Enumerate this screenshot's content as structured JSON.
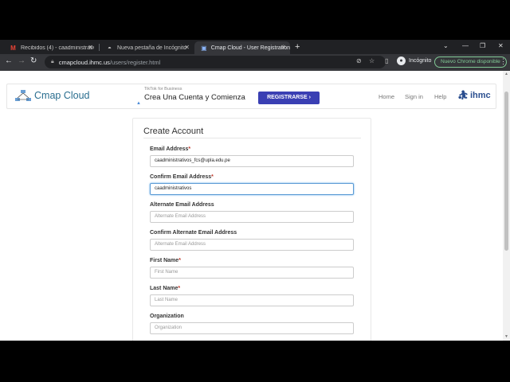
{
  "browser": {
    "tabs": [
      {
        "label": "Recibidos (4) - caadministrativos",
        "icon": "gmail-icon"
      },
      {
        "label": "Nueva pestaña de Incógnito",
        "icon": "incognito-icon"
      },
      {
        "label": "Cmap Cloud - User Registration",
        "icon": "cmap-icon"
      }
    ],
    "url_host": "cmapcloud.ihmc.us",
    "url_path": "/users/register.html",
    "profile_label": "Incógnito",
    "update_label": "Nuevo Chrome disponible"
  },
  "header": {
    "logo_text": "Cmap Cloud",
    "ad": {
      "sponsor": "TikTok for Business",
      "title": "Crea Una Cuenta y Comienza",
      "button": "REGISTRARSE ›"
    },
    "nav": [
      "Home",
      "Sign in",
      "Help"
    ],
    "org_logo": "ihmc"
  },
  "form": {
    "title": "Create Account",
    "fields": [
      {
        "label": "Email Address",
        "required": true,
        "value": "caadministrativos_fcs@upla.edu.pe",
        "placeholder": ""
      },
      {
        "label": "Confirm Email Address",
        "required": true,
        "value": "caadministrativos",
        "placeholder": ""
      },
      {
        "label": "Alternate Email Address",
        "required": false,
        "value": "",
        "placeholder": "Alternate Email Address"
      },
      {
        "label": "Confirm Alternate Email Address",
        "required": false,
        "value": "",
        "placeholder": "Alternate Email Address"
      },
      {
        "label": "First Name",
        "required": true,
        "value": "",
        "placeholder": "First Name"
      },
      {
        "label": "Last Name",
        "required": true,
        "value": "",
        "placeholder": "Last Name"
      },
      {
        "label": "Organization",
        "required": false,
        "value": "",
        "placeholder": "Organization"
      }
    ],
    "required_marker": "*"
  },
  "colors": {
    "accent": "#2a6e8f",
    "ad_button": "#3a3fb3",
    "required": "#c0392b"
  }
}
